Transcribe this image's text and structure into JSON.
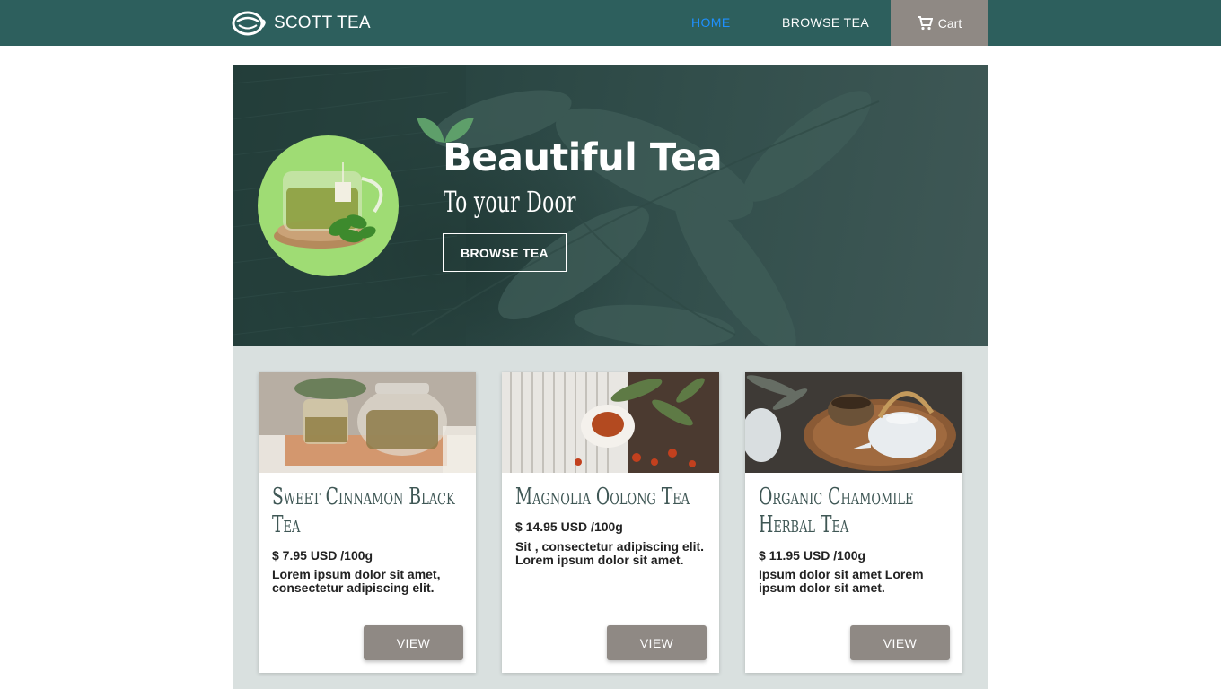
{
  "navbar": {
    "brand": "SCOTT TEA",
    "links": {
      "home": "HOME",
      "browse": "BROWSE TEA"
    },
    "cart_label": "Cart",
    "colors": {
      "background": "#2d5f5d",
      "active_link": "#1e90ff",
      "cart_bg": "#8f8984"
    }
  },
  "hero": {
    "title": "Beautiful Tea",
    "subtitle": "To your Door",
    "button_label": "BROWSE TEA"
  },
  "products": [
    {
      "name": "Sweet Cinnamon Black Tea",
      "price": "$ 7.95 USD  /100g",
      "description": "Lorem ipsum dolor sit amet, consectetur adipiscing elit.",
      "button_label": "VIEW"
    },
    {
      "name": "Magnolia Oolong Tea",
      "price": "$ 14.95 USD  /100g",
      "description": "Sit , consectetur adipiscing elit. Lorem ipsum dolor sit amet.",
      "button_label": "VIEW"
    },
    {
      "name": "Organic Chamomile Herbal Tea",
      "price": "$ 11.95 USD  /100g",
      "description": "Ipsum dolor sit amet Lorem ipsum dolor sit amet.",
      "button_label": "VIEW"
    }
  ],
  "icons": {
    "brand": "tea-cup-icon",
    "cart": "cart-icon",
    "hero_leaf": "leaf-icon"
  }
}
